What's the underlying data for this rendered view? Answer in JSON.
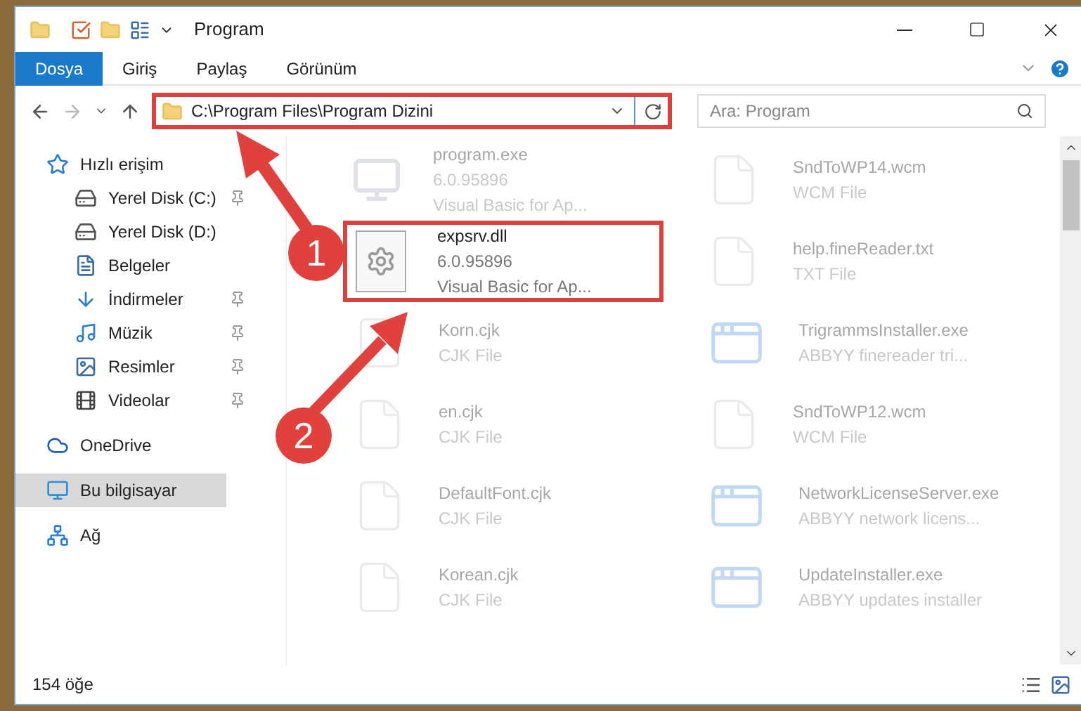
{
  "window": {
    "title": "Program"
  },
  "ribbon_tabs": [
    {
      "label": "Dosya",
      "selected": true
    },
    {
      "label": "Giriş",
      "selected": false
    },
    {
      "label": "Paylaş",
      "selected": false
    },
    {
      "label": "Görünüm",
      "selected": false
    }
  ],
  "address": {
    "path": "C:\\Program Files\\Program Dizini",
    "highlighted": true
  },
  "search": {
    "placeholder": "Ara: Program"
  },
  "nav": [
    {
      "label": "Hızlı erişim",
      "kind": "star",
      "selected": false,
      "children": [
        {
          "label": "Yerel Disk (C:)",
          "kind": "drive",
          "pinned": true
        },
        {
          "label": "Yerel Disk (D:)",
          "kind": "drive",
          "pinned": false
        },
        {
          "label": "Belgeler",
          "kind": "document",
          "pinned": false
        },
        {
          "label": "İndirmeler",
          "kind": "download",
          "pinned": true
        },
        {
          "label": "Müzik",
          "kind": "music",
          "pinned": true
        },
        {
          "label": "Resimler",
          "kind": "picture",
          "pinned": true
        },
        {
          "label": "Videolar",
          "kind": "video",
          "pinned": true
        }
      ]
    },
    {
      "label": "OneDrive",
      "kind": "cloud",
      "selected": false
    },
    {
      "label": "Bu bilgisayar",
      "kind": "computer",
      "selected": true
    },
    {
      "label": "Ağ",
      "kind": "network",
      "selected": false
    }
  ],
  "files": [
    {
      "name": "program.exe",
      "lines": [
        "6.0.95896",
        "Visual Basic for Ap..."
      ],
      "kind": "program",
      "highlighted": false
    },
    {
      "name": "SndToWP14.wcm",
      "lines": [
        "WCM File"
      ],
      "kind": "document",
      "highlighted": false
    },
    {
      "name": "expsrv.dll",
      "lines": [
        "6.0.95896",
        "Visual Basic for Ap..."
      ],
      "kind": "gear",
      "highlighted": true
    },
    {
      "name": "help.fineReader.txt",
      "lines": [
        "TXT File"
      ],
      "kind": "document",
      "highlighted": false
    },
    {
      "name": "Korn.cjk",
      "lines": [
        "CJK File"
      ],
      "kind": "document",
      "highlighted": false
    },
    {
      "name": "TrigrammsInstaller.exe",
      "lines": [
        "ABBYY finereader tri..."
      ],
      "kind": "app",
      "highlighted": false
    },
    {
      "name": "en.cjk",
      "lines": [
        "CJK File"
      ],
      "kind": "document",
      "highlighted": false
    },
    {
      "name": "SndToWP12.wcm",
      "lines": [
        "WCM File"
      ],
      "kind": "document",
      "highlighted": false
    },
    {
      "name": "DefaultFont.cjk",
      "lines": [
        "CJK File"
      ],
      "kind": "document",
      "highlighted": false
    },
    {
      "name": "NetworkLicenseServer.exe",
      "lines": [
        "ABBYY network licens..."
      ],
      "kind": "app",
      "highlighted": false
    },
    {
      "name": "Korean.cjk",
      "lines": [
        "CJK File"
      ],
      "kind": "document",
      "highlighted": false
    },
    {
      "name": "UpdateInstaller.exe",
      "lines": [
        "ABBYY updates installer"
      ],
      "kind": "app",
      "highlighted": false
    }
  ],
  "status_bar": {
    "count": "154 öğe"
  },
  "annotations": [
    {
      "number": "1"
    },
    {
      "number": "2"
    }
  ]
}
